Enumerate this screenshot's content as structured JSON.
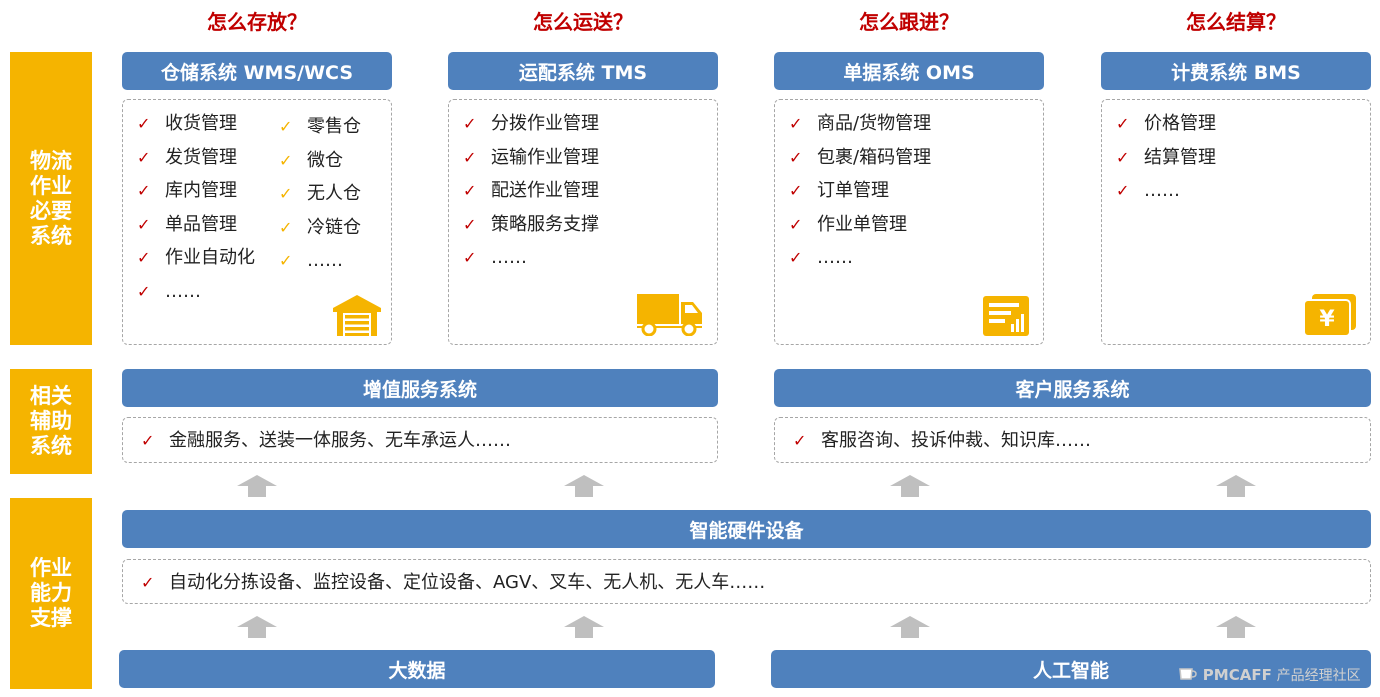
{
  "questions": [
    "怎么存放？",
    "怎么运送？",
    "怎么跟进？",
    "怎么结算？"
  ],
  "side_labels": {
    "essential": [
      "物流",
      "作业",
      "必要",
      "系统"
    ],
    "auxiliary": [
      "相关",
      "辅助",
      "系统"
    ],
    "capability": [
      "作业",
      "能力",
      "支撑"
    ]
  },
  "systems": {
    "wms": {
      "title": "仓储系统 WMS/WCS",
      "items_left": [
        "收货管理",
        "发货管理",
        "库内管理",
        "单品管理",
        "作业自动化",
        "……"
      ],
      "items_right": [
        "零售仓",
        "微仓",
        "无人仓",
        "冷链仓",
        "……"
      ],
      "icon": "warehouse-icon"
    },
    "tms": {
      "title": "运配系统 TMS",
      "items": [
        "分拨作业管理",
        "运输作业管理",
        "配送作业管理",
        "策略服务支撑",
        "……"
      ],
      "icon": "truck-icon"
    },
    "oms": {
      "title": "单据系统 OMS",
      "items": [
        "商品/货物管理",
        "包裹/箱码管理",
        "订单管理",
        "作业单管理",
        "……"
      ],
      "icon": "document-chart-icon"
    },
    "bms": {
      "title": "计费系统 BMS",
      "items": [
        "价格管理",
        "结算管理",
        "……"
      ],
      "icon": "yuan-wallet-icon"
    }
  },
  "auxiliary": {
    "value_added": {
      "title": "增值服务系统",
      "line": "金融服务、送装一体服务、无车承运人……"
    },
    "customer": {
      "title": "客户服务系统",
      "line": "客服咨询、投诉仲裁、知识库……"
    }
  },
  "hardware": {
    "title": "智能硬件设备",
    "line": "自动化分拣设备、监控设备、定位设备、AGV、叉车、无人机、无人车……"
  },
  "foundation": {
    "bigdata": "大数据",
    "ai": "人工智能"
  },
  "check_mark": "✓",
  "watermark": {
    "brand": "PMCAFF",
    "text": "产品经理社区"
  },
  "colors": {
    "accent_blue": "#4f81bd",
    "side_gold": "#f5b400",
    "question_red": "#c00000",
    "arrow_gray": "#bfbfbf"
  }
}
